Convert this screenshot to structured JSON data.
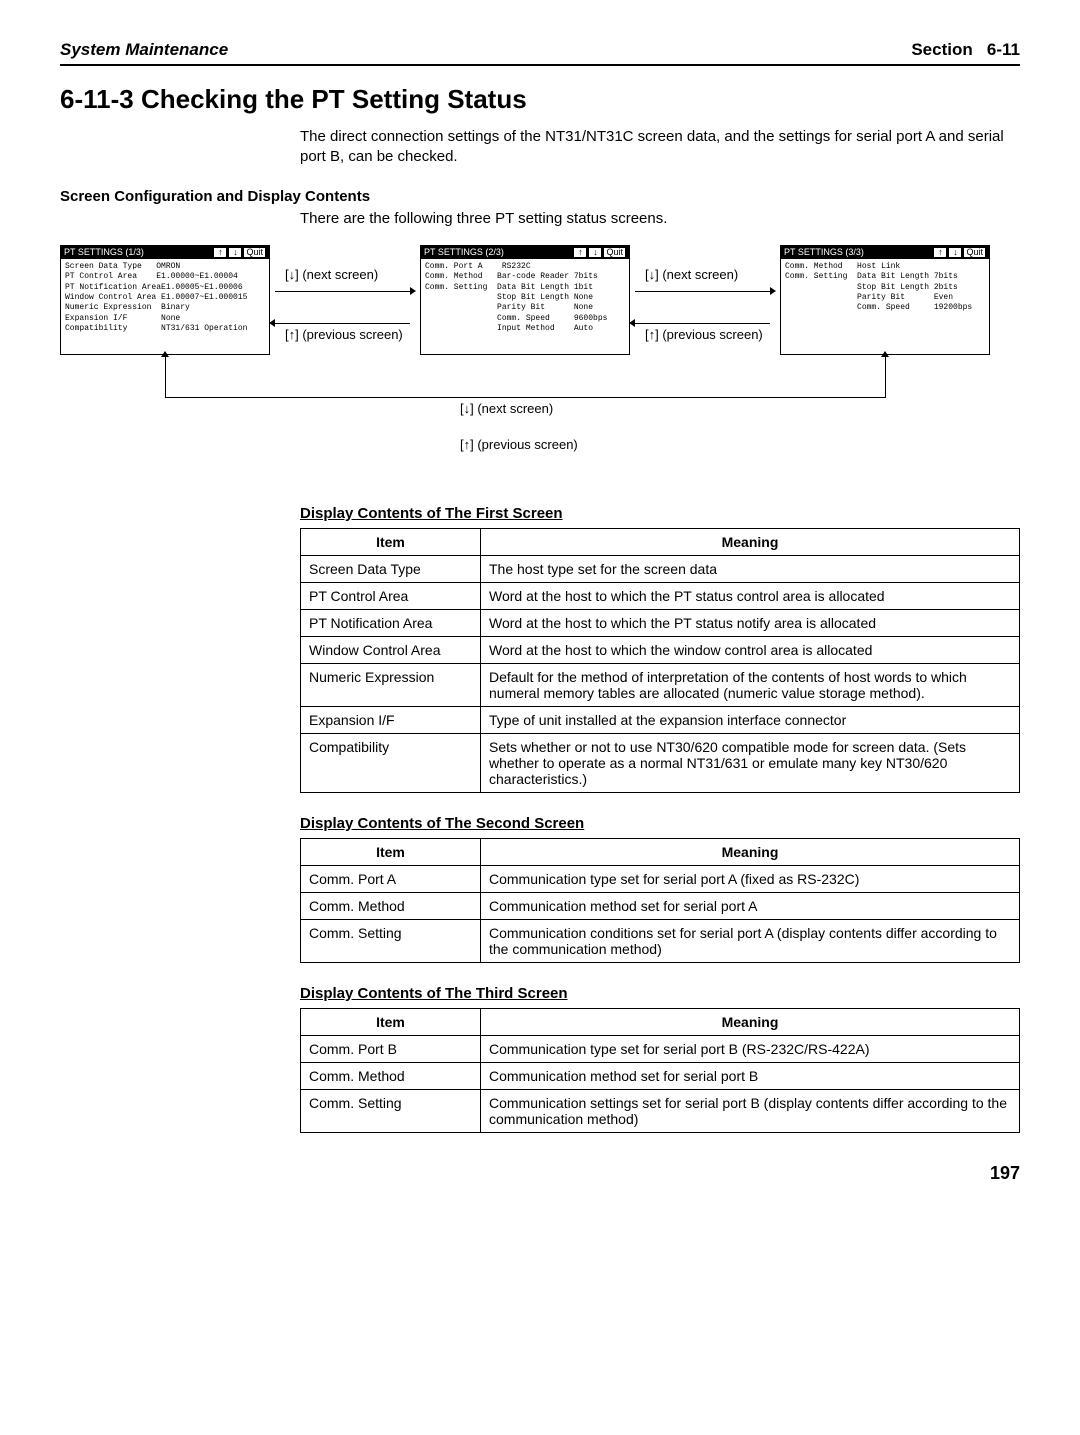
{
  "header": {
    "left": "System Maintenance",
    "section_label": "Section",
    "section_number": "6-11"
  },
  "title": "6-11-3 Checking the PT Setting Status",
  "intro_para": "The direct connection settings of the NT31/NT31C screen data, and the settings for serial port A and serial port B, can be checked.",
  "config_head": "Screen Configuration and Display Contents",
  "config_intro": "There are the following three PT setting status screens.",
  "diagram": {
    "screens": [
      {
        "bar_left": "PT SETTINGS",
        "bar_right": "(1/3)",
        "quit": "Quit",
        "body": "Screen Data Type   OMRON\nPT Control Area    E1.00000~E1.00004\nPT Notification AreaE1.00005~E1.00006\nWindow Control Area E1.00007~E1.000015\nNumeric Expression  Binary\nExpansion I/F       None\nCompatibility       NT31/631 Operation"
      },
      {
        "bar_left": "PT SETTINGS",
        "bar_right": "(2/3)",
        "quit": "Quit",
        "body": "Comm. Port A    RS232C\nComm. Method   Bar-code Reader 7bits\nComm. Setting  Data Bit Length 1bit\n               Stop Bit Length None\n               Parity Bit      None\n               Comm. Speed     9600bps\n               Input Method    Auto"
      },
      {
        "bar_left": "PT SETTINGS",
        "bar_right": "(3/3)",
        "quit": "Quit",
        "body": "Comm. Method   Host Link\nComm. Setting  Data Bit Length 7bits\n               Stop Bit Length 2bits\n               Parity Bit      Even\n               Comm. Speed     19200bps"
      }
    ],
    "next_label": "[↓] (next screen)",
    "prev_label": "[↑] (previous screen)",
    "next_center": "[↓] (next screen)",
    "prev_center": "[↑] (previous screen)"
  },
  "tables": {
    "first": {
      "title": "Display Contents of The First Screen",
      "head_item": "Item",
      "head_meaning": "Meaning",
      "rows": [
        {
          "item": "Screen Data Type",
          "meaning": "The host type set for the screen data"
        },
        {
          "item": "PT Control Area",
          "meaning": "Word at the host to which the PT status control area is allocated"
        },
        {
          "item": "PT Notification Area",
          "meaning": "Word at the host to which the PT status notify area is allocated"
        },
        {
          "item": "Window Control Area",
          "meaning": "Word at the host to which the window control area is allocated"
        },
        {
          "item": "Numeric Expression",
          "meaning": "Default for the method of interpretation of the contents of host words to which numeral memory tables are allocated (numeric value storage method)."
        },
        {
          "item": "Expansion I/F",
          "meaning": "Type of unit installed at the expansion interface connector"
        },
        {
          "item": "Compatibility",
          "meaning": "Sets whether or not to use NT30/620 compatible mode for screen data. (Sets whether to operate as a normal NT31/631 or emulate many key NT30/620 characteristics.)"
        }
      ]
    },
    "second": {
      "title": "Display Contents of The Second Screen",
      "head_item": "Item",
      "head_meaning": "Meaning",
      "rows": [
        {
          "item": "Comm. Port A",
          "meaning": "Communication type set for serial port A (fixed as RS-232C)"
        },
        {
          "item": "Comm. Method",
          "meaning": "Communication method set for serial port A"
        },
        {
          "item": "Comm. Setting",
          "meaning": "Communication conditions set for serial port A (display contents differ according to the communication method)"
        }
      ]
    },
    "third": {
      "title": "Display Contents of The Third Screen",
      "head_item": "Item",
      "head_meaning": "Meaning",
      "rows": [
        {
          "item": "Comm. Port B",
          "meaning": "Communication type set for serial port B (RS-232C/RS-422A)"
        },
        {
          "item": "Comm. Method",
          "meaning": "Communication method set for serial port B"
        },
        {
          "item": "Comm. Setting",
          "meaning": "Communication settings set for serial port B (display contents differ according to the communication method)"
        }
      ]
    }
  },
  "page_number": "197"
}
